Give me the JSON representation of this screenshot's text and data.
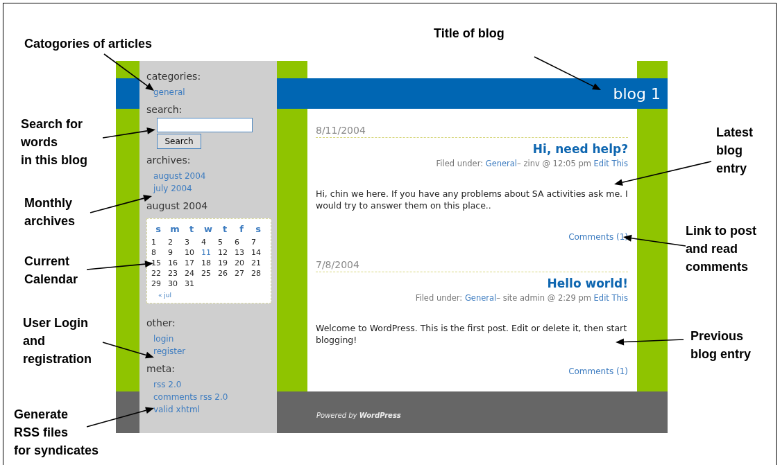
{
  "annotations": [
    {
      "text": "Catogories of articles"
    },
    {
      "text": "Search for\nwords\nin this blog"
    },
    {
      "text": "Monthly\narchives"
    },
    {
      "text": "Current\nCalendar"
    },
    {
      "text": "User Login\nand\nregistration"
    },
    {
      "text": "Generate\nRSS files\nfor syndicates"
    },
    {
      "text": "Title of blog"
    },
    {
      "text": "Latest\nblog\nentry"
    },
    {
      "text": "Link to post\nand read\ncomments"
    },
    {
      "text": "Previous\nblog entry"
    }
  ],
  "blog": {
    "title": "blog 1",
    "sidebar": [
      {
        "kind": "links",
        "heading": "categories:",
        "links": [
          "general"
        ]
      },
      {
        "kind": "search",
        "heading": "search:",
        "button": "Search"
      },
      {
        "kind": "links",
        "heading": "archives:",
        "links": [
          "august 2004",
          "july 2004"
        ]
      },
      {
        "kind": "calendar",
        "heading": "august 2004",
        "weekdays": [
          "s",
          "m",
          "t",
          "w",
          "t",
          "f",
          "s"
        ],
        "weeks": [
          [
            {
              "day": "1",
              "linked": false
            },
            {
              "day": "2",
              "linked": false
            },
            {
              "day": "3",
              "linked": false
            },
            {
              "day": "4",
              "linked": false
            },
            {
              "day": "5",
              "linked": false
            },
            {
              "day": "6",
              "linked": false
            },
            {
              "day": "7",
              "linked": false
            }
          ],
          [
            {
              "day": "8",
              "linked": false
            },
            {
              "day": "9",
              "linked": false
            },
            {
              "day": "10",
              "linked": false
            },
            {
              "day": "11",
              "linked": true
            },
            {
              "day": "12",
              "linked": false
            },
            {
              "day": "13",
              "linked": false
            },
            {
              "day": "14",
              "linked": false
            }
          ],
          [
            {
              "day": "15",
              "linked": false
            },
            {
              "day": "16",
              "linked": false
            },
            {
              "day": "17",
              "linked": false
            },
            {
              "day": "18",
              "linked": false
            },
            {
              "day": "19",
              "linked": false
            },
            {
              "day": "20",
              "linked": false
            },
            {
              "day": "21",
              "linked": false
            }
          ],
          [
            {
              "day": "22",
              "linked": false
            },
            {
              "day": "23",
              "linked": false
            },
            {
              "day": "24",
              "linked": false
            },
            {
              "day": "25",
              "linked": false
            },
            {
              "day": "26",
              "linked": false
            },
            {
              "day": "27",
              "linked": false
            },
            {
              "day": "28",
              "linked": false
            }
          ],
          [
            {
              "day": "29",
              "linked": false
            },
            {
              "day": "30",
              "linked": false
            },
            {
              "day": "31",
              "linked": false
            }
          ]
        ],
        "prev_link": "« jul"
      },
      {
        "kind": "links",
        "heading": "other:",
        "links": [
          "login",
          "register"
        ]
      },
      {
        "kind": "links",
        "heading": "meta:",
        "links": [
          "rss 2.0",
          "comments rss 2.0",
          "valid xhtml"
        ]
      }
    ],
    "posts": [
      {
        "date": "8/11/2004",
        "title": "Hi, need help?",
        "filed_label": "Filed under:",
        "category": "General",
        "byline": "– zinv @ 12:05 pm",
        "edit": "Edit This",
        "body": "Hi, chin we here. If you have any problems about SA activities ask me. I would try to answer them on this place..",
        "comments": "Comments (1)"
      },
      {
        "date": "7/8/2004",
        "title": "Hello world!",
        "filed_label": "Filed under:",
        "category": "General",
        "byline": "– site admin @ 2:29 pm",
        "edit": "Edit This",
        "body": "Welcome to WordPress. This is the first post. Edit or delete it, then start blogging!",
        "comments": "Comments (1)"
      }
    ],
    "footer": "Powered by **WordPress**"
  }
}
